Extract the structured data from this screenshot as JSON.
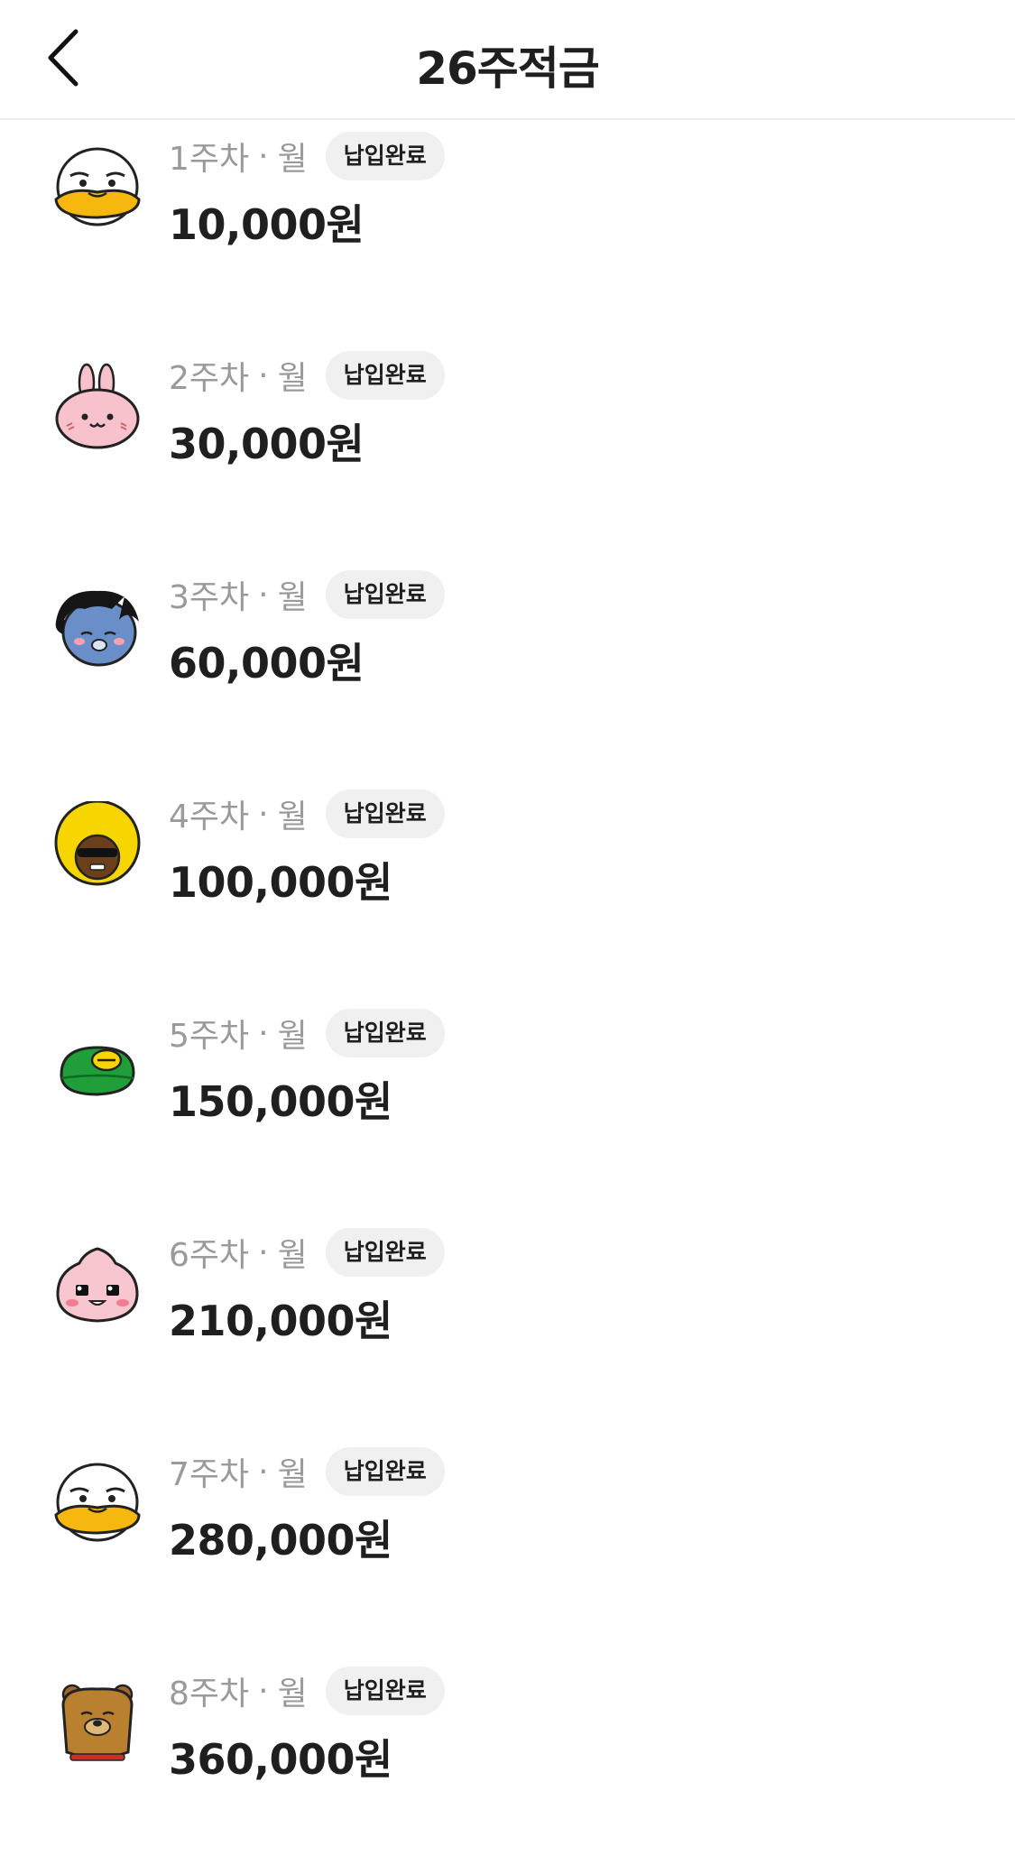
{
  "header": {
    "title": "26주적금",
    "back_icon": "chevron-left-icon"
  },
  "items": [
    {
      "week": "1주차",
      "sep": "·",
      "day": "월",
      "status": "납입완료",
      "amount": "10,000원",
      "avatar": "duck-character-icon"
    },
    {
      "week": "2주차",
      "sep": "·",
      "day": "월",
      "status": "납입완료",
      "amount": "30,000원",
      "avatar": "pink-rabbit-character-icon"
    },
    {
      "week": "3주차",
      "sep": "·",
      "day": "월",
      "status": "납입완료",
      "amount": "60,000원",
      "avatar": "black-cat-character-icon"
    },
    {
      "week": "4주차",
      "sep": "·",
      "day": "월",
      "status": "납입완료",
      "amount": "100,000원",
      "avatar": "afro-character-icon"
    },
    {
      "week": "5주차",
      "sep": "·",
      "day": "월",
      "status": "납입완료",
      "amount": "150,000원",
      "avatar": "green-crocodile-character-icon"
    },
    {
      "week": "6주차",
      "sep": "·",
      "day": "월",
      "status": "납입완료",
      "amount": "210,000원",
      "avatar": "peach-character-icon"
    },
    {
      "week": "7주차",
      "sep": "·",
      "day": "월",
      "status": "납입완료",
      "amount": "280,000원",
      "avatar": "duck-character-icon"
    },
    {
      "week": "8주차",
      "sep": "·",
      "day": "월",
      "status": "납입완료",
      "amount": "360,000원",
      "avatar": "bear-character-icon"
    }
  ]
}
